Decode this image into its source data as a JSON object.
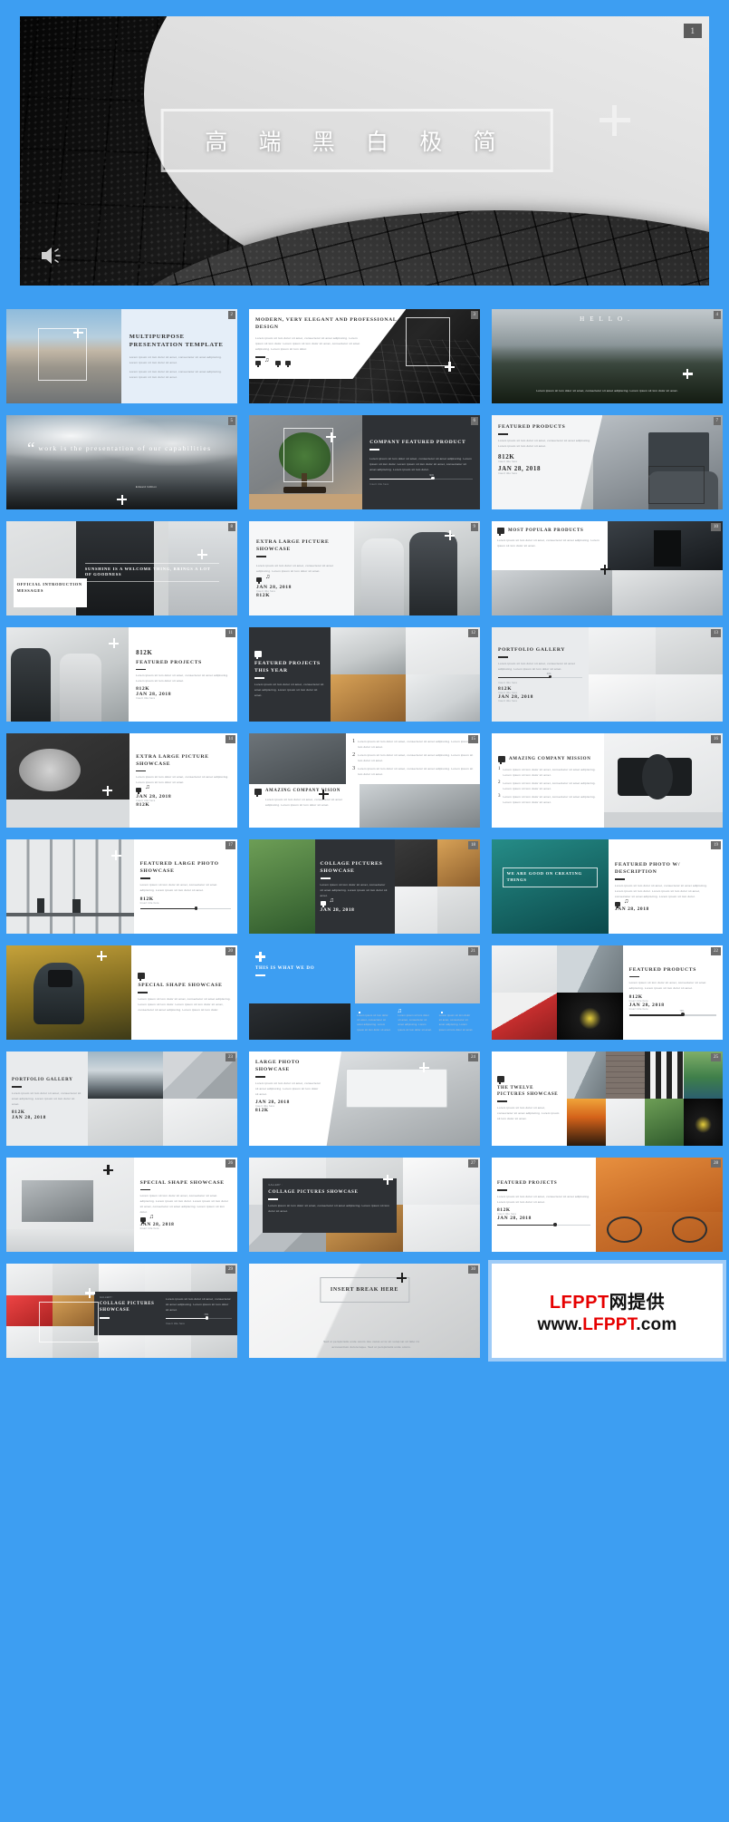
{
  "hero": {
    "title": "高 端 黑 白 极 简",
    "slide_number": "1",
    "speaker_icon": "speaker-icon",
    "plus_icon": "plus-icon"
  },
  "brand": {
    "line1_red": "LFPPT",
    "line1_black": "网提供",
    "line2_pre": "www.",
    "line2_red": "LFPPT",
    "line2_post": ".com"
  },
  "common": {
    "lorem_short": "Lorem ipsum sit lom dolor sit amet, consectetur sit amet adipiscing. Lorem ipsum sit lom dolor sit amet.",
    "lorem_long": "Lorem ipsum sit lom dolor sit amet, consectetur sit amet adipiscing. Lorem ipsum sit lom dolor. Lorem ipsum sit lom dolor sit amet, consectetur sit amet adipiscing. Lorem ipsum sit lom dolor.",
    "stat": "812K",
    "date": "JAN 28, 2018",
    "insert_title": "Insert title here",
    "percent": "73%",
    "percent2": "60%"
  },
  "slides": [
    {
      "n": "2",
      "title": "MULTIPURPOSE PRESENTATION TEMPLATE"
    },
    {
      "n": "3",
      "title": "MODERN, VERY ELEGANT AND PROFESSIONAL DESIGN"
    },
    {
      "n": "4",
      "title": "HELLO."
    },
    {
      "n": "5",
      "title": "work is the presentation of our capabilities",
      "author": "Edward Gibbon"
    },
    {
      "n": "6",
      "title": "COMPANY FEATURED PRODUCT"
    },
    {
      "n": "7",
      "title": "FEATURED PRODUCTS"
    },
    {
      "n": "8",
      "title": "OFFICIAL INTRODUCTION MESSAGES",
      "title2": "SUNSHINE IS A WELCOME THING, BRINGS A LOT OF GOODNESS"
    },
    {
      "n": "9",
      "title": "EXTRA LARGE PICTURE SHOWCASE"
    },
    {
      "n": "10",
      "title": "MOST POPULAR PRODUCTS"
    },
    {
      "n": "11",
      "title": "FEATURED PROJECTS"
    },
    {
      "n": "12",
      "title": "FEATURED PROJECTS THIS YEAR"
    },
    {
      "n": "13",
      "title": "PORTFOLIO GALLERY"
    },
    {
      "n": "14",
      "title": "EXTRA LARGE PICTURE SHOWCASE"
    },
    {
      "n": "15",
      "title": "AMAZING COMPANY VISION"
    },
    {
      "n": "16",
      "title": "AMAZING COMPANY MISSION"
    },
    {
      "n": "17",
      "title": "FEATURED LARGE PHOTO SHOWCASE"
    },
    {
      "n": "18",
      "title": "COLLAGE PICTURES SHOWCASE"
    },
    {
      "n": "19",
      "title": "FEATURED PHOTO W/ DESCRIPTION",
      "title2": "WE ARE GOOD ON CREATING THINGS"
    },
    {
      "n": "20",
      "title": "SPECIAL SHAPE SHOWCASE"
    },
    {
      "n": "21",
      "title": "THIS IS WHAT WE DO"
    },
    {
      "n": "22",
      "title": "FEATURED PRODUCTS"
    },
    {
      "n": "23",
      "title": "PORTFOLIO GALLERY"
    },
    {
      "n": "24",
      "title": "LARGE PHOTO SHOWCASE"
    },
    {
      "n": "25",
      "title": "THE TWELVE PICTURES SHOWCASE"
    },
    {
      "n": "26",
      "title": "SPECIAL SHAPE SHOWCASE"
    },
    {
      "n": "27",
      "title": "COLLAGE PICTURES SHOWCASE",
      "label": "GALLERY :"
    },
    {
      "n": "28",
      "title": "FEATURED PROJECTS"
    },
    {
      "n": "29",
      "title": "COLLAGE PICTURES SHOWCASE",
      "label": "GALLERY :"
    },
    {
      "n": "30",
      "title": "INSERT BREAK HERE",
      "body": "Sed ut perspiciatis unde omnis iste natus error sit volup tat sit labo ris accusantium doloremque. Sed ut perspiciatis unde omnis."
    }
  ],
  "icon_names": [
    "screen-icon",
    "music-note-icon",
    "monitor-icon",
    "chat-icon"
  ]
}
